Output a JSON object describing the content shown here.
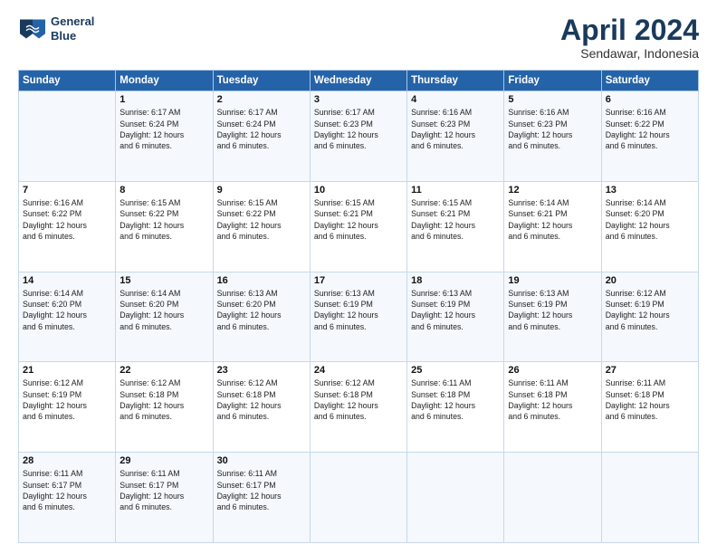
{
  "header": {
    "logo_line1": "General",
    "logo_line2": "Blue",
    "title": "April 2024",
    "subtitle": "Sendawar, Indonesia"
  },
  "days_of_week": [
    "Sunday",
    "Monday",
    "Tuesday",
    "Wednesday",
    "Thursday",
    "Friday",
    "Saturday"
  ],
  "weeks": [
    [
      {
        "day": "",
        "info": ""
      },
      {
        "day": "1",
        "info": "Sunrise: 6:17 AM\nSunset: 6:24 PM\nDaylight: 12 hours\nand 6 minutes."
      },
      {
        "day": "2",
        "info": "Sunrise: 6:17 AM\nSunset: 6:24 PM\nDaylight: 12 hours\nand 6 minutes."
      },
      {
        "day": "3",
        "info": "Sunrise: 6:17 AM\nSunset: 6:23 PM\nDaylight: 12 hours\nand 6 minutes."
      },
      {
        "day": "4",
        "info": "Sunrise: 6:16 AM\nSunset: 6:23 PM\nDaylight: 12 hours\nand 6 minutes."
      },
      {
        "day": "5",
        "info": "Sunrise: 6:16 AM\nSunset: 6:23 PM\nDaylight: 12 hours\nand 6 minutes."
      },
      {
        "day": "6",
        "info": "Sunrise: 6:16 AM\nSunset: 6:22 PM\nDaylight: 12 hours\nand 6 minutes."
      }
    ],
    [
      {
        "day": "7",
        "info": "Sunrise: 6:16 AM\nSunset: 6:22 PM\nDaylight: 12 hours\nand 6 minutes."
      },
      {
        "day": "8",
        "info": "Sunrise: 6:15 AM\nSunset: 6:22 PM\nDaylight: 12 hours\nand 6 minutes."
      },
      {
        "day": "9",
        "info": "Sunrise: 6:15 AM\nSunset: 6:22 PM\nDaylight: 12 hours\nand 6 minutes."
      },
      {
        "day": "10",
        "info": "Sunrise: 6:15 AM\nSunset: 6:21 PM\nDaylight: 12 hours\nand 6 minutes."
      },
      {
        "day": "11",
        "info": "Sunrise: 6:15 AM\nSunset: 6:21 PM\nDaylight: 12 hours\nand 6 minutes."
      },
      {
        "day": "12",
        "info": "Sunrise: 6:14 AM\nSunset: 6:21 PM\nDaylight: 12 hours\nand 6 minutes."
      },
      {
        "day": "13",
        "info": "Sunrise: 6:14 AM\nSunset: 6:20 PM\nDaylight: 12 hours\nand 6 minutes."
      }
    ],
    [
      {
        "day": "14",
        "info": "Sunrise: 6:14 AM\nSunset: 6:20 PM\nDaylight: 12 hours\nand 6 minutes."
      },
      {
        "day": "15",
        "info": "Sunrise: 6:14 AM\nSunset: 6:20 PM\nDaylight: 12 hours\nand 6 minutes."
      },
      {
        "day": "16",
        "info": "Sunrise: 6:13 AM\nSunset: 6:20 PM\nDaylight: 12 hours\nand 6 minutes."
      },
      {
        "day": "17",
        "info": "Sunrise: 6:13 AM\nSunset: 6:19 PM\nDaylight: 12 hours\nand 6 minutes."
      },
      {
        "day": "18",
        "info": "Sunrise: 6:13 AM\nSunset: 6:19 PM\nDaylight: 12 hours\nand 6 minutes."
      },
      {
        "day": "19",
        "info": "Sunrise: 6:13 AM\nSunset: 6:19 PM\nDaylight: 12 hours\nand 6 minutes."
      },
      {
        "day": "20",
        "info": "Sunrise: 6:12 AM\nSunset: 6:19 PM\nDaylight: 12 hours\nand 6 minutes."
      }
    ],
    [
      {
        "day": "21",
        "info": "Sunrise: 6:12 AM\nSunset: 6:19 PM\nDaylight: 12 hours\nand 6 minutes."
      },
      {
        "day": "22",
        "info": "Sunrise: 6:12 AM\nSunset: 6:18 PM\nDaylight: 12 hours\nand 6 minutes."
      },
      {
        "day": "23",
        "info": "Sunrise: 6:12 AM\nSunset: 6:18 PM\nDaylight: 12 hours\nand 6 minutes."
      },
      {
        "day": "24",
        "info": "Sunrise: 6:12 AM\nSunset: 6:18 PM\nDaylight: 12 hours\nand 6 minutes."
      },
      {
        "day": "25",
        "info": "Sunrise: 6:11 AM\nSunset: 6:18 PM\nDaylight: 12 hours\nand 6 minutes."
      },
      {
        "day": "26",
        "info": "Sunrise: 6:11 AM\nSunset: 6:18 PM\nDaylight: 12 hours\nand 6 minutes."
      },
      {
        "day": "27",
        "info": "Sunrise: 6:11 AM\nSunset: 6:18 PM\nDaylight: 12 hours\nand 6 minutes."
      }
    ],
    [
      {
        "day": "28",
        "info": "Sunrise: 6:11 AM\nSunset: 6:17 PM\nDaylight: 12 hours\nand 6 minutes."
      },
      {
        "day": "29",
        "info": "Sunrise: 6:11 AM\nSunset: 6:17 PM\nDaylight: 12 hours\nand 6 minutes."
      },
      {
        "day": "30",
        "info": "Sunrise: 6:11 AM\nSunset: 6:17 PM\nDaylight: 12 hours\nand 6 minutes."
      },
      {
        "day": "",
        "info": ""
      },
      {
        "day": "",
        "info": ""
      },
      {
        "day": "",
        "info": ""
      },
      {
        "day": "",
        "info": ""
      }
    ]
  ]
}
